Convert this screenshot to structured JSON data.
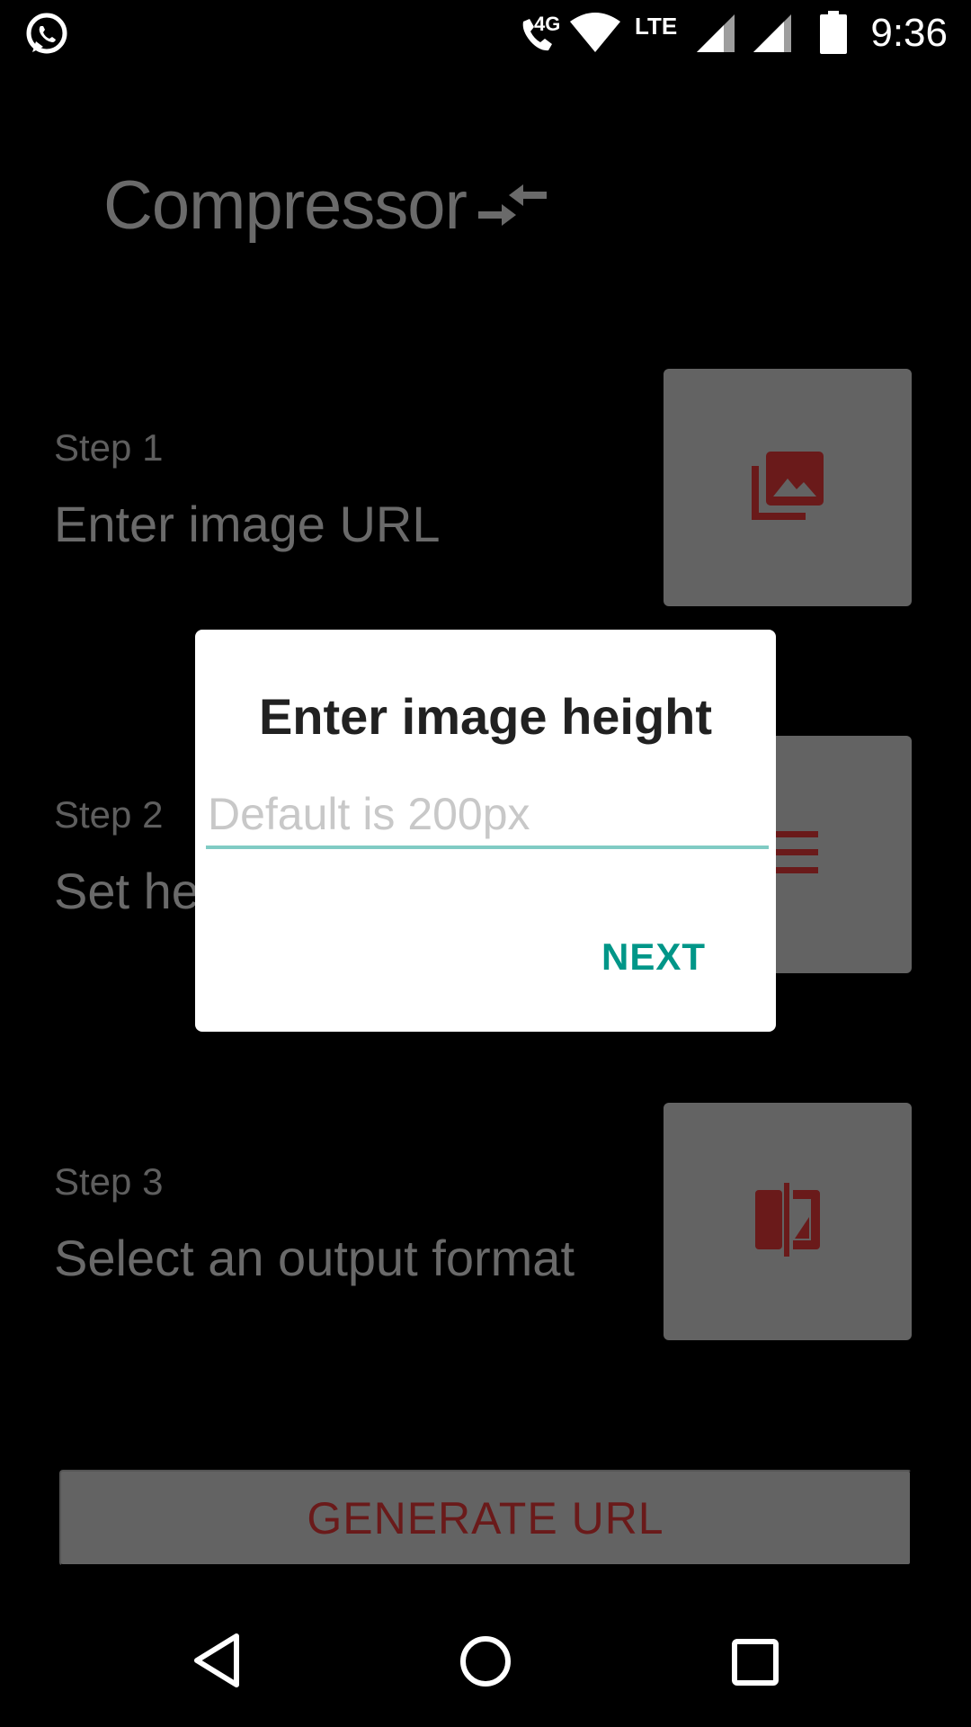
{
  "status_bar": {
    "time": "9:36",
    "network_label": "LTE",
    "call_label": "4G",
    "icons": [
      "whatsapp-icon",
      "volte-call-icon",
      "wifi-icon",
      "signal-icon",
      "signal-icon",
      "battery-icon"
    ]
  },
  "app": {
    "title": "Compressor",
    "title_icon": "compress-arrows-icon",
    "accent_dark": "#6a1a1a"
  },
  "steps": [
    {
      "label": "Step 1",
      "description": "Enter image URL",
      "icon": "photo-library-icon"
    },
    {
      "label": "Step 2",
      "description": "Set he",
      "icon": "menu-icon"
    },
    {
      "label": "Step 3",
      "description": "Select an output format",
      "icon": "compare-icon"
    }
  ],
  "generate_button": {
    "label": "GENERATE URL"
  },
  "dialog": {
    "title": "Enter image height",
    "input_value": "",
    "input_placeholder": "Default is 200px",
    "next_label": "NEXT",
    "accent": "#009688"
  },
  "nav_bar": {
    "buttons": [
      "back-icon",
      "home-icon",
      "recents-icon"
    ]
  }
}
